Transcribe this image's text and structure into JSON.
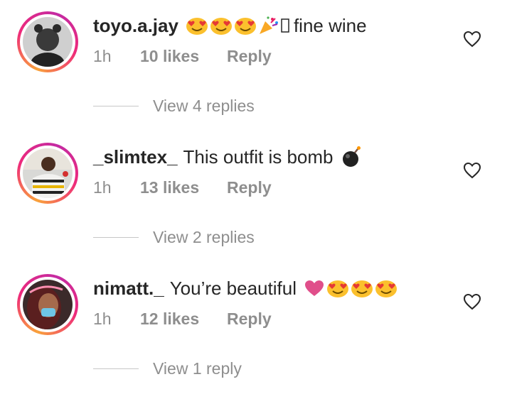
{
  "comments": [
    {
      "username": "toyo.a.jay",
      "text": "fine wine",
      "emojis": [
        "heart-eyes-emoji",
        "heart-eyes-emoji",
        "heart-eyes-emoji",
        "party-popper-emoji",
        "unknown-glyph"
      ],
      "time": "1h",
      "likes": "10 likes",
      "reply": "Reply",
      "view_replies": "View 4 replies"
    },
    {
      "username": "_slimtex_",
      "text": "This outfit is bomb",
      "emojis": [
        "bomb-emoji"
      ],
      "time": "1h",
      "likes": "13 likes",
      "reply": "Reply",
      "view_replies": "View 2 replies"
    },
    {
      "username": "nimatt._",
      "text": "You’re beautiful",
      "emojis": [
        "pink-heart-emoji",
        "heart-eyes-emoji",
        "heart-eyes-emoji",
        "heart-eyes-emoji"
      ],
      "time": "1h",
      "likes": "12 likes",
      "reply": "Reply",
      "view_replies": "View 1 reply"
    }
  ],
  "colors": {
    "ring_start": "#f9a23b",
    "ring_mid": "#ee2a7b",
    "ring_end": "#c32aa3",
    "meta_gray": "#8e8e8e",
    "text": "#262626"
  }
}
